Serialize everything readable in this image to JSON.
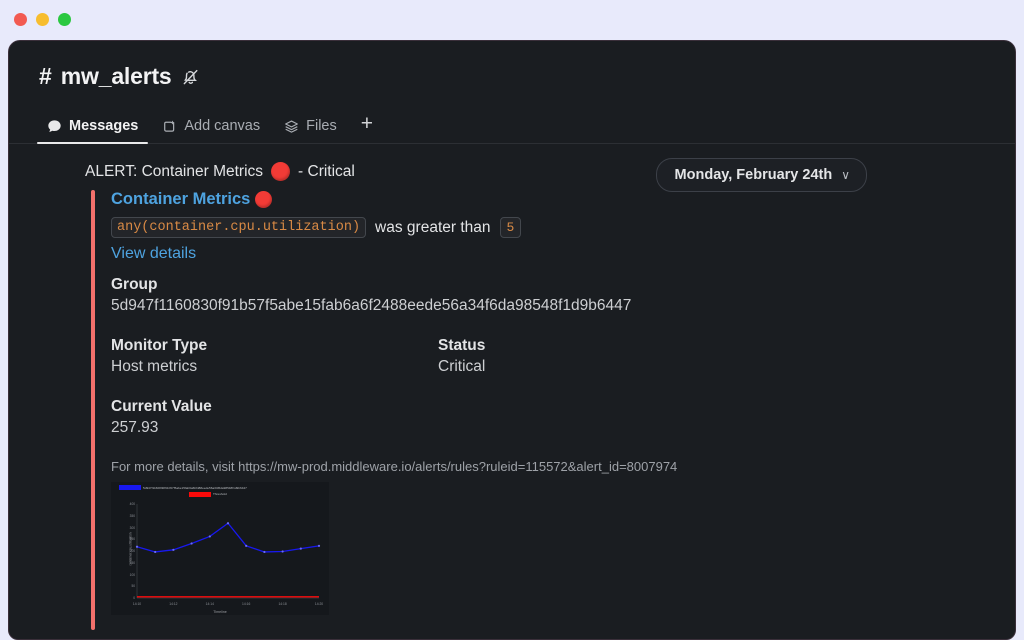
{
  "window": {
    "traffic_lights": [
      "close",
      "minimize",
      "maximize"
    ],
    "colors": {
      "close": "#f25a51",
      "minimize": "#f7bd2e",
      "maximize": "#2bc840",
      "background": "#1a1d21",
      "desktop": "#e8eafb",
      "accent_bar": "#f2706b",
      "link": "#4ea3e0",
      "critical": "#f23b36",
      "code": "#d98a45"
    }
  },
  "channel": {
    "hash": "#",
    "name": "mw_alerts",
    "mute_icon": "bell-muted-icon"
  },
  "tabs": [
    {
      "label": "Messages",
      "icon": "chat-bubble-icon",
      "active": true
    },
    {
      "label": "Add canvas",
      "icon": "canvas-icon",
      "active": false
    },
    {
      "label": "Files",
      "icon": "layers-icon",
      "active": false
    }
  ],
  "add_tab_label": "+",
  "date_pill": {
    "label": "Monday, February 24th",
    "chevron": "∨"
  },
  "message": {
    "title_prefix": "ALERT: Container Metrics",
    "title_suffix": "- Critical",
    "attachment": {
      "heading": "Container Metrics",
      "condition_code": "any(container.cpu.utilization)",
      "condition_text": "was greater than",
      "condition_threshold": "5",
      "view_details": "View details",
      "fields": [
        {
          "label": "Group",
          "value": "5d947f1160830f91b57f5abe15fab6a6f2488eede56a34f6da98548f1d9b6447"
        },
        {
          "label": "Monitor Type",
          "value": "Host metrics"
        },
        {
          "label": "Status",
          "value": "Critical"
        },
        {
          "label": "Current Value",
          "value": "257.93"
        }
      ],
      "footer": "For more details, visit https://mw-prod.middleware.io/alerts/rules?ruleid=115572&alert_id=8007974"
    }
  },
  "chart_data": {
    "type": "line",
    "title": "",
    "xlabel": "Timeline",
    "ylabel": "container.cpu.utilization",
    "ylim": [
      0,
      400
    ],
    "yticks": [
      0,
      50,
      100,
      150,
      200,
      250,
      300,
      350,
      400
    ],
    "x": [
      "14:10",
      "14:12",
      "14:14",
      "14:16",
      "14:18",
      "14:20"
    ],
    "xticks": [
      "14:10",
      "14:12",
      "14:14",
      "14:16",
      "14:18",
      "14:20"
    ],
    "legend": [
      {
        "label": "5d947f1160830f91b57f5abe15fab6a6f2488eede56a34f6da98548f1d9b6447",
        "color": "#1818f0"
      },
      {
        "label": "Threshold",
        "color": "#fa0a0a"
      }
    ],
    "series": [
      {
        "name": "5d947f1160830f91b57f5abe15fab6a6f2488eede56a34f6da98548f1d9b6447",
        "color": "#1818f0",
        "values": [
          218,
          196,
          205,
          232,
          262,
          318,
          222,
          196,
          198,
          210,
          222
        ]
      },
      {
        "name": "Threshold",
        "color": "#fa0a0a",
        "values": [
          5,
          5,
          5,
          5,
          5,
          5,
          5,
          5,
          5,
          5,
          5
        ]
      }
    ],
    "grid": false,
    "legend_position": "top"
  }
}
